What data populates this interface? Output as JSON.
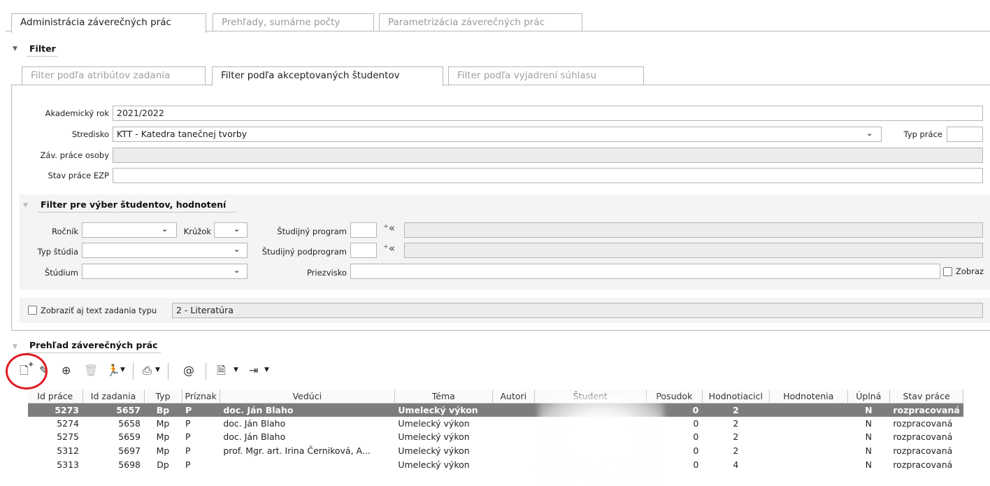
{
  "main_tabs": [
    {
      "label": "Administrácia záverečných prác",
      "active": true
    },
    {
      "label": "Prehľady, sumárne počty",
      "active": false
    },
    {
      "label": "Parametrizácia záverečných prác",
      "active": false
    }
  ],
  "filter": {
    "title": "Filter",
    "tabs": [
      {
        "label": "Filter podľa atribútov zadania",
        "active": false
      },
      {
        "label": "Filter podľa akceptovaných študentov",
        "active": true
      },
      {
        "label": "Filter podľa vyjadrení súhlasu",
        "active": false
      }
    ],
    "akademicky_rok_label": "Akademický rok",
    "akademicky_rok_value": "2021/2022",
    "stredisko_label": "Stredisko",
    "stredisko_value": "KTT - Katedra tanečnej tvorby",
    "typ_prace_label": "Typ práce",
    "typ_prace_value": "",
    "zav_prace_osoby_label": "Záv. práce osoby",
    "zav_prace_osoby_value": "",
    "stav_prace_label": "Stav práce EZP",
    "stav_prace_value": ""
  },
  "student_filter": {
    "title": "Filter pre výber študentov, hodnotení",
    "rocnik_label": "Ročník",
    "rocnik_value": "",
    "kruzok_label": "Krúžok",
    "kruzok_value": "",
    "program_label": "Študijný program",
    "program_value": "",
    "typ_studia_label": "Typ štúdia",
    "typ_studia_value": "",
    "podprogram_label": "Študijný podprogram",
    "podprogram_value": "",
    "studium_label": "Štúdium",
    "studium_value": "",
    "priezvisko_label": "Priezvisko",
    "priezvisko_value": "",
    "zobrazit_label": "Zobraz"
  },
  "zadanie": {
    "checkbox_label": "Zobraziť aj text zadania typu",
    "value": "2 - Literatúra"
  },
  "overview": {
    "title": "Prehľad záverečných prác"
  },
  "table": {
    "columns": [
      "Id práce",
      "Id zadania",
      "Typ",
      "Príznak",
      "Vedúci",
      "Téma",
      "Autori",
      "Študent",
      "Posudok",
      "Hodnotiacicl",
      "Hodnotenia",
      "Úplná",
      "Stav práce"
    ],
    "rows": [
      {
        "id_prace": "5273",
        "id_zadania": "5657",
        "typ": "Bp",
        "priznak": "P",
        "veduci": "doc. Ján Blaho",
        "tema": "Umelecký výkon",
        "autori": "",
        "student": "",
        "posudok": "0",
        "hodnotiaci": "2",
        "hodnotenia": "",
        "uplna": "N",
        "stav": "rozpracovaná",
        "selected": true
      },
      {
        "id_prace": "5274",
        "id_zadania": "5658",
        "typ": "Mp",
        "priznak": "P",
        "veduci": "doc. Ján Blaho",
        "tema": "Umelecký výkon",
        "autori": "",
        "student": "",
        "posudok": "0",
        "hodnotiaci": "2",
        "hodnotenia": "",
        "uplna": "N",
        "stav": "rozpracovaná",
        "selected": false
      },
      {
        "id_prace": "5275",
        "id_zadania": "5659",
        "typ": "Mp",
        "priznak": "P",
        "veduci": "doc. Ján Blaho",
        "tema": "Umelecký výkon",
        "autori": "",
        "student": "",
        "posudok": "0",
        "hodnotiaci": "2",
        "hodnotenia": "",
        "uplna": "N",
        "stav": "rozpracovaná",
        "selected": false
      },
      {
        "id_prace": "5312",
        "id_zadania": "5697",
        "typ": "Mp",
        "priznak": "P",
        "veduci": "prof. Mgr. art. Irina Černiková, A...",
        "tema": "Umelecký výkon",
        "autori": "",
        "student": "",
        "posudok": "0",
        "hodnotiaci": "2",
        "hodnotenia": "",
        "uplna": "N",
        "stav": "rozpracovaná",
        "selected": false
      },
      {
        "id_prace": "5313",
        "id_zadania": "5698",
        "typ": "Dp",
        "priznak": "P",
        "veduci": "",
        "tema": "Umelecký výkon",
        "autori": "",
        "student": "",
        "posudok": "0",
        "hodnotiaci": "4",
        "hodnotenia": "",
        "uplna": "N",
        "stav": "rozpracovaná",
        "selected": false
      }
    ]
  },
  "colors": {
    "selected_row": "#7d7d7d",
    "highlight_circle": "#e01b24",
    "border": "#b8b8b8"
  }
}
